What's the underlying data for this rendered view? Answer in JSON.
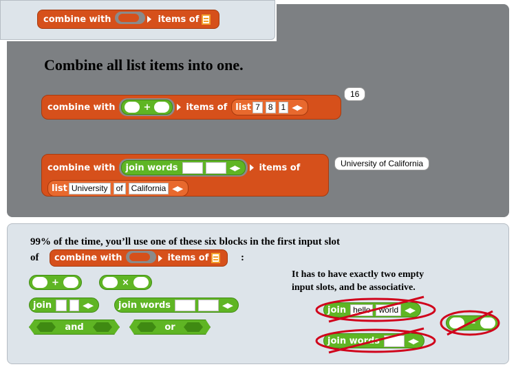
{
  "top_block": {
    "combine_label": "combine with",
    "items_label": "items of"
  },
  "heading": "Combine all list items into one.",
  "example1": {
    "combine_label": "combine with",
    "plus": "+",
    "items_label": "items of",
    "list_label": "list",
    "list_values": [
      "7",
      "8",
      "1"
    ],
    "result": "16"
  },
  "example2": {
    "combine_label": "combine with",
    "join_label": "join words",
    "items_label": "items of",
    "list_label": "list",
    "list_values": [
      "University",
      "of",
      "California"
    ],
    "result": "University of California"
  },
  "note": {
    "line1": "99% of the time, you’ll use one of these six blocks in the first input slot",
    "line2_prefix": "of",
    "line2_suffix": ":",
    "inline_block": {
      "combine_label": "combine with",
      "items_label": "items of"
    }
  },
  "six_blocks": {
    "plus": "+",
    "times": "×",
    "join": "join",
    "join_words": "join words",
    "and": "and",
    "or": "or"
  },
  "rule": {
    "line1": "It has to have exactly two empty",
    "line2": "input slots, and be associative."
  },
  "bad_blocks": {
    "join_label": "join",
    "join_v1": "hello",
    "join_v2": "world",
    "join_words_label": "join words",
    "minus": "−"
  },
  "colors": {
    "orange": "#d6501b",
    "green": "#5fb524",
    "gray_panel": "#7d8083",
    "light_panel": "#dde4ea",
    "red_mark": "#d0021b"
  }
}
